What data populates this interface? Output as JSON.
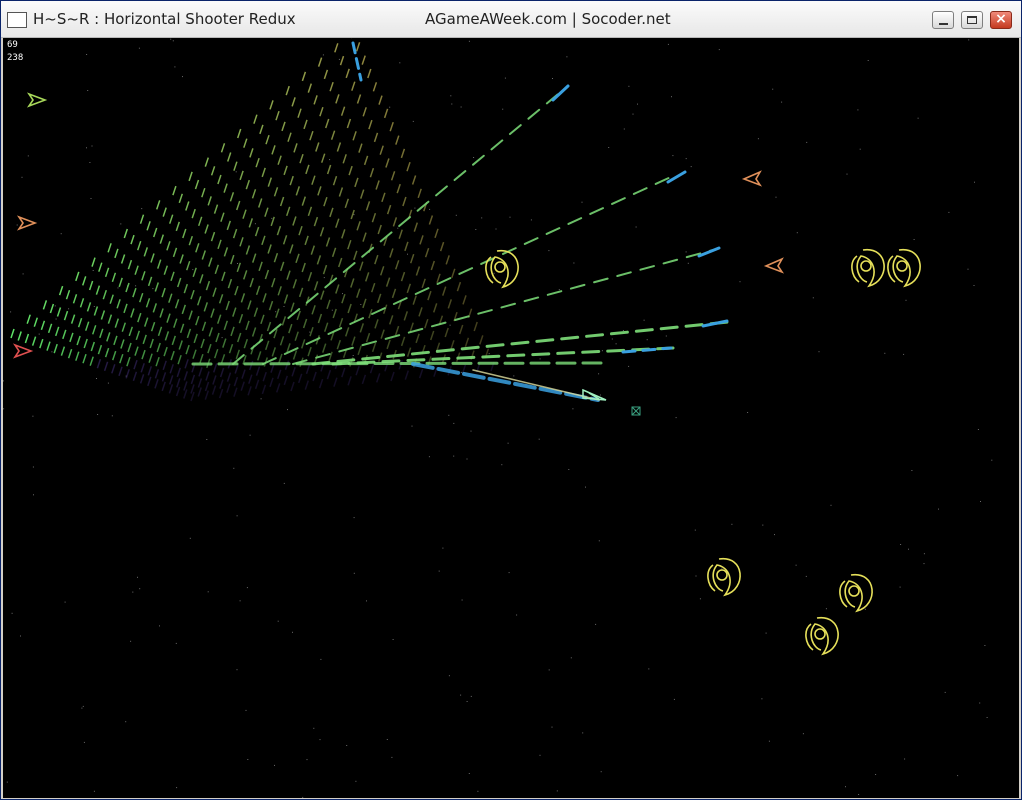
{
  "window": {
    "title": "H~S~R : Horizontal Shooter Redux",
    "subtitle": "AGameAWeek.com | Socoder.net",
    "controls": {
      "minimize": "minimize",
      "maximize": "maximize",
      "close": "close"
    }
  },
  "hud": {
    "value_a": "69",
    "value_b": "238"
  },
  "colors": {
    "enemy_pod": "#e6e05a",
    "arrow_enemy": "#e0905a",
    "laser_blue": "#3aa0e0",
    "trail_green": "#7ee07a",
    "player": "#a0f0c0"
  }
}
